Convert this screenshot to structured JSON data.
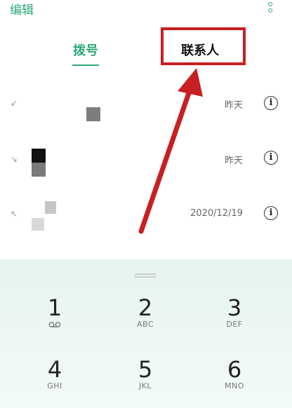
{
  "header": {
    "edit_label": "编辑"
  },
  "tabs": [
    {
      "label": "拨号"
    },
    {
      "label": "联系人"
    }
  ],
  "calls": [
    {
      "time": "昨天"
    },
    {
      "time": "昨天"
    },
    {
      "time": "2020/12/19"
    }
  ],
  "keypad": {
    "keys": [
      {
        "digit": "1",
        "sub": ""
      },
      {
        "digit": "2",
        "sub": "ABC"
      },
      {
        "digit": "3",
        "sub": "DEF"
      },
      {
        "digit": "4",
        "sub": "GHI"
      },
      {
        "digit": "5",
        "sub": "JKL"
      },
      {
        "digit": "6",
        "sub": "MNO"
      }
    ]
  },
  "icons": {
    "more": "more-vertical-icon",
    "info": "info-icon",
    "voicemail": "voicemail-icon",
    "incoming": "incoming-call-arrow-icon"
  },
  "colors": {
    "accent": "#2aa876",
    "annotation": "#c71f22"
  }
}
